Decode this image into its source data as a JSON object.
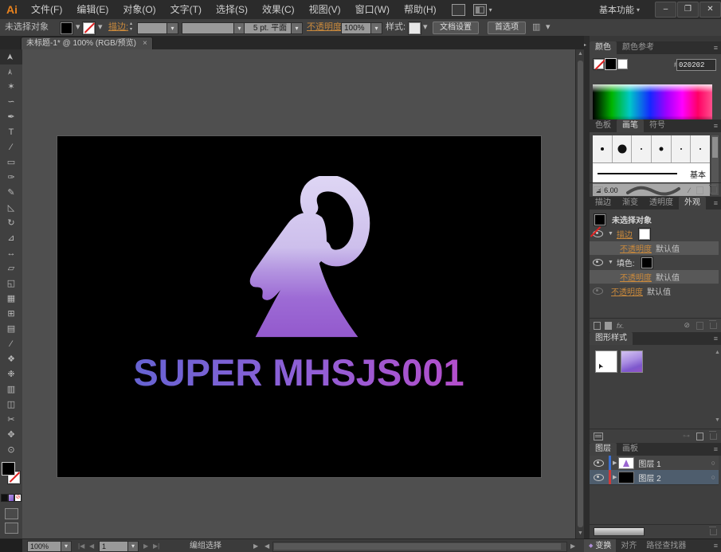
{
  "menubar": {
    "logo": "Ai",
    "items": [
      {
        "label": "文件(F)"
      },
      {
        "label": "编辑(E)"
      },
      {
        "label": "对象(O)"
      },
      {
        "label": "文字(T)"
      },
      {
        "label": "选择(S)"
      },
      {
        "label": "效果(C)"
      },
      {
        "label": "视图(V)"
      },
      {
        "label": "窗口(W)"
      },
      {
        "label": "帮助(H)"
      }
    ],
    "workspace": "基本功能",
    "window_buttons": {
      "minimize": "–",
      "restore": "❐",
      "close": "✕"
    }
  },
  "controlbar": {
    "selection_status": "未选择对象",
    "stroke_label": "描边:",
    "brush_definition": "5 pt. 平面",
    "opacity_label": "不透明度:",
    "opacity_value": "100%",
    "style_label": "样式:",
    "document_setup_button": "文档设置",
    "preferences_button": "首选项"
  },
  "doc_tab": {
    "label": "未标题-1* @ 100% (RGB/预览)",
    "close": "×"
  },
  "toolbar": {
    "tools": [
      {
        "name": "selection-tool",
        "glyph": "➤"
      },
      {
        "name": "direct-selection-tool",
        "glyph": "➣"
      },
      {
        "name": "magic-wand-tool",
        "glyph": "✶"
      },
      {
        "name": "lasso-tool",
        "glyph": "∽"
      },
      {
        "name": "pen-tool",
        "glyph": "✒"
      },
      {
        "name": "type-tool",
        "glyph": "T"
      },
      {
        "name": "line-segment-tool",
        "glyph": "∕"
      },
      {
        "name": "rectangle-tool",
        "glyph": "▭"
      },
      {
        "name": "paintbrush-tool",
        "glyph": "✑"
      },
      {
        "name": "pencil-tool",
        "glyph": "✎"
      },
      {
        "name": "eraser-tool",
        "glyph": "◺"
      },
      {
        "name": "rotate-tool",
        "glyph": "↻"
      },
      {
        "name": "scale-tool",
        "glyph": "⊿"
      },
      {
        "name": "width-tool",
        "glyph": "↔"
      },
      {
        "name": "free-transform-tool",
        "glyph": "▱"
      },
      {
        "name": "shape-builder-tool",
        "glyph": "◱"
      },
      {
        "name": "perspective-grid-tool",
        "glyph": "▦"
      },
      {
        "name": "mesh-tool",
        "glyph": "⊞"
      },
      {
        "name": "gradient-tool",
        "glyph": "▤"
      },
      {
        "name": "eyedropper-tool",
        "glyph": "⁄"
      },
      {
        "name": "blend-tool",
        "glyph": "❖"
      },
      {
        "name": "symbol-sprayer-tool",
        "glyph": "❉"
      },
      {
        "name": "column-graph-tool",
        "glyph": "▥"
      },
      {
        "name": "artboard-tool",
        "glyph": "◫"
      },
      {
        "name": "slice-tool",
        "glyph": "✂"
      },
      {
        "name": "hand-tool",
        "glyph": "✥"
      },
      {
        "name": "zoom-tool",
        "glyph": "⊙"
      }
    ]
  },
  "artwork": {
    "logo_text": "SUPER MHSJS001",
    "logo_gradient_top": "#ded6f4",
    "logo_gradient_bottom": "#9155cb",
    "text_gradient_left": "#6663d2",
    "text_gradient_right": "#b44ecb"
  },
  "panels": {
    "color": {
      "tabs": [
        "颜色",
        "颜色参考"
      ],
      "hex_prefix": "#",
      "hex_value": "020202"
    },
    "brushes": {
      "tabs": [
        "色板",
        "画笔",
        "符号"
      ],
      "basic_brush": "基本",
      "charcoal_size": "6.00"
    },
    "appearance": {
      "tabs": [
        "描边",
        "渐变",
        "透明度",
        "外观"
      ],
      "selection_status": "未选择对象",
      "stroke_row": "描边",
      "fill_row": "填色:",
      "opacity_link": "不透明度",
      "default_value": "默认值",
      "fx": "fx."
    },
    "graphic_styles": {
      "title": "图形样式"
    },
    "layers": {
      "tabs": [
        "图层",
        "画板"
      ],
      "rows": [
        {
          "label": "图层 1"
        },
        {
          "label": "图层 2"
        }
      ]
    },
    "dock_tabs": {
      "labels": [
        "变换",
        "对齐",
        "路径查找器"
      ]
    }
  },
  "statusbar": {
    "zoom_value": "100%",
    "artboard_number": "1",
    "current_tool": "编组选择"
  },
  "icons": {
    "panel_menu": "≡",
    "target": "○",
    "expand": "▶",
    "collapse": "▼",
    "diamond": "◆",
    "none": "⊘",
    "clear": "⊘"
  }
}
